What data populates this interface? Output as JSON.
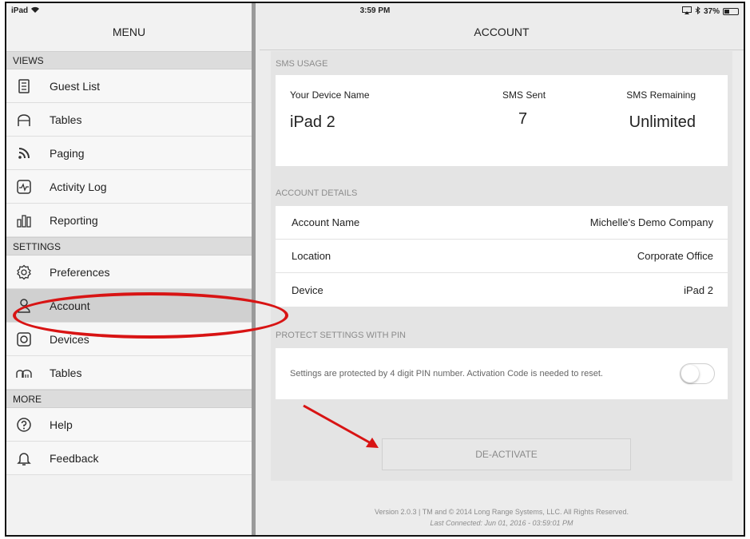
{
  "status_bar": {
    "device": "iPad",
    "time": "3:59 PM",
    "battery": "37%",
    "battery_level": 0.37,
    "icons": [
      "wifi-icon",
      "airplay-icon",
      "bluetooth-icon",
      "battery-icon"
    ]
  },
  "sidebar": {
    "title": "MENU",
    "sections": [
      {
        "header": "VIEWS",
        "items": [
          {
            "label": "Guest List",
            "icon": "list-icon"
          },
          {
            "label": "Tables",
            "icon": "table-icon"
          },
          {
            "label": "Paging",
            "icon": "paging-icon"
          },
          {
            "label": "Activity Log",
            "icon": "activity-icon"
          },
          {
            "label": "Reporting",
            "icon": "bar-chart-icon"
          }
        ]
      },
      {
        "header": "SETTINGS",
        "items": [
          {
            "label": "Preferences",
            "icon": "gear-icon"
          },
          {
            "label": "Account",
            "icon": "user-icon",
            "active": true
          },
          {
            "label": "Devices",
            "icon": "device-icon"
          },
          {
            "label": "Tables",
            "icon": "tables-setting-icon"
          }
        ]
      },
      {
        "header": "MORE",
        "items": [
          {
            "label": "Help",
            "icon": "help-icon"
          },
          {
            "label": "Feedback",
            "icon": "bell-icon"
          }
        ]
      }
    ]
  },
  "main": {
    "title": "ACCOUNT",
    "sms_usage": {
      "label": "SMS USAGE",
      "device_name_label": "Your Device Name",
      "device_name": "iPad 2",
      "sms_sent_label": "SMS Sent",
      "sms_sent": "7",
      "sms_remaining_label": "SMS Remaining",
      "sms_remaining": "Unlimited"
    },
    "account_details": {
      "label": "ACCOUNT DETAILS",
      "rows": [
        {
          "label": "Account Name",
          "value": "Michelle's Demo Company"
        },
        {
          "label": "Location",
          "value": "Corporate Office"
        },
        {
          "label": "Device",
          "value": "iPad 2"
        }
      ]
    },
    "pin": {
      "label": "PROTECT SETTINGS WITH PIN",
      "description": "Settings are protected by 4 digit PIN number. Activation Code is needed to reset.",
      "enabled": false
    },
    "deactivate_label": "DE-ACTIVATE",
    "footer": {
      "version": "Version 2.0.3 | TM and © 2014 Long Range Systems, LLC. All Rights Reserved.",
      "last_connected": "Last Connected: Jun 01, 2016 - 03:59:01 PM"
    }
  },
  "annotation_color": "#d81414"
}
